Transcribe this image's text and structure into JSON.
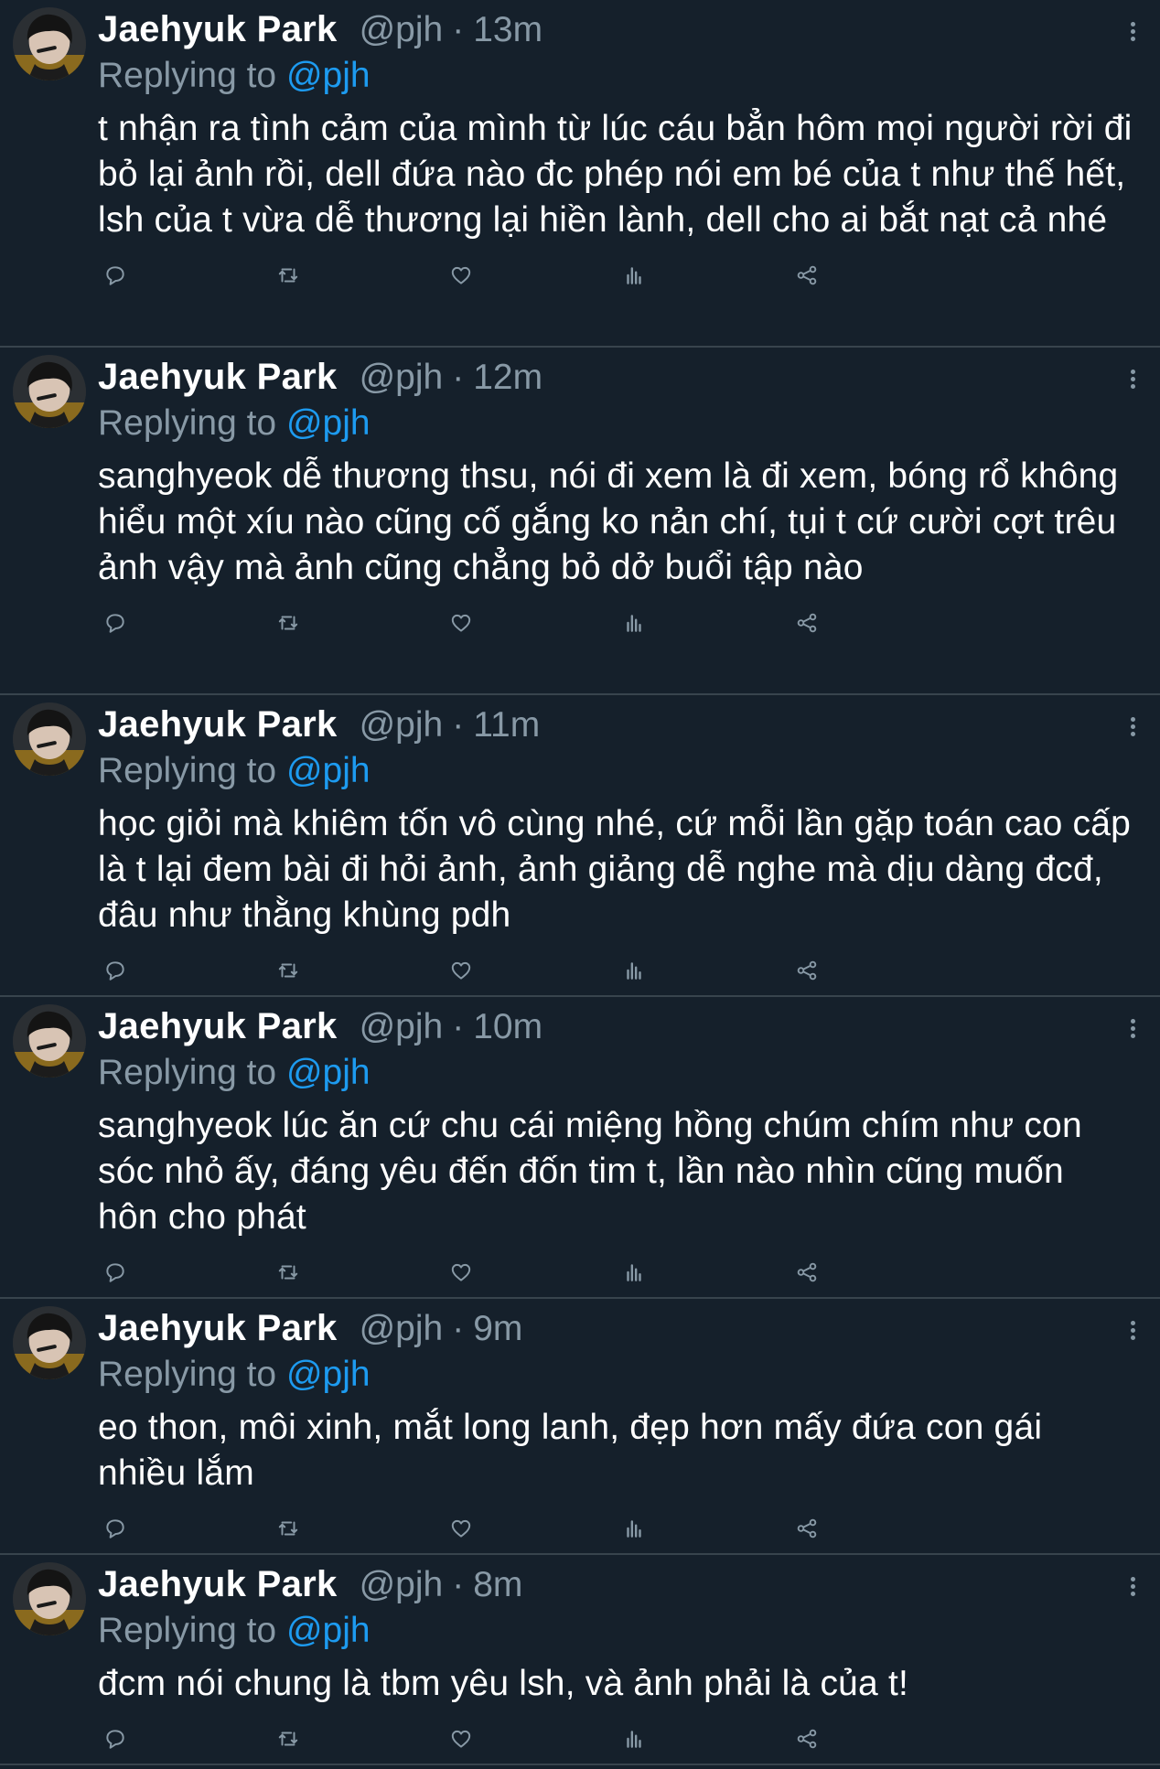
{
  "tweets": [
    {
      "name": "Jaehyuk Park",
      "handle": "@pjh",
      "sep": "·",
      "time": "13m",
      "replying_prefix": "Replying to ",
      "replying_to": "@pjh",
      "text": "t nhận ra tình cảm của mình từ lúc cáu bẳn hôm mọi người rời đi bỏ lại ảnh rồi, dell đứa nào đc phép nói em bé của t như thế hết, lsh của t vừa dễ thương lại hiền lành, dell cho ai bắt nạt cả nhé"
    },
    {
      "name": "Jaehyuk Park",
      "handle": "@pjh",
      "sep": "·",
      "time": "12m",
      "replying_prefix": "Replying to ",
      "replying_to": "@pjh",
      "text": "sanghyeok dễ thương thsu, nói đi xem là đi xem, bóng rổ không hiểu một xíu nào cũng cố gắng ko nản chí, tụi t cứ cười cợt trêu ảnh vậy mà ảnh cũng chẳng bỏ dở buổi tập nào"
    },
    {
      "name": "Jaehyuk Park",
      "handle": "@pjh",
      "sep": "·",
      "time": "11m",
      "replying_prefix": "Replying to ",
      "replying_to": "@pjh",
      "text": "học giỏi mà khiêm tốn vô cùng nhé, cứ mỗi lần gặp toán cao cấp là t lại đem bài đi hỏi ảnh, ảnh giảng dễ nghe mà dịu dàng đcđ, đâu như thằng khùng pdh"
    },
    {
      "name": "Jaehyuk Park",
      "handle": "@pjh",
      "sep": "·",
      "time": "10m",
      "replying_prefix": "Replying to ",
      "replying_to": "@pjh",
      "text": "sanghyeok lúc ăn cứ chu cái miệng hồng chúm chím như con sóc nhỏ ấy, đáng yêu đến đốn tim t, lần nào nhìn cũng muốn hôn cho phát"
    },
    {
      "name": "Jaehyuk Park",
      "handle": "@pjh",
      "sep": "·",
      "time": "9m",
      "replying_prefix": "Replying to ",
      "replying_to": "@pjh",
      "text": "eo thon, môi xinh, mắt long lanh, đẹp hơn mấy đứa con gái nhiều lắm"
    },
    {
      "name": "Jaehyuk Park",
      "handle": "@pjh",
      "sep": "·",
      "time": "8m",
      "replying_prefix": "Replying to ",
      "replying_to": "@pjh",
      "text": "đcm nói chung là tbm yêu lsh, và ảnh phải là của t!"
    }
  ],
  "icons": {
    "reply": "reply-icon",
    "retweet": "retweet-icon",
    "like": "heart-icon",
    "analytics": "analytics-icon",
    "share": "share-icon",
    "more": "more-options-icon"
  },
  "colors": {
    "background": "#15202b",
    "divider": "#38444d",
    "secondary_text": "#8899a6",
    "mention": "#1d9bf0",
    "primary_text": "#ffffff"
  }
}
